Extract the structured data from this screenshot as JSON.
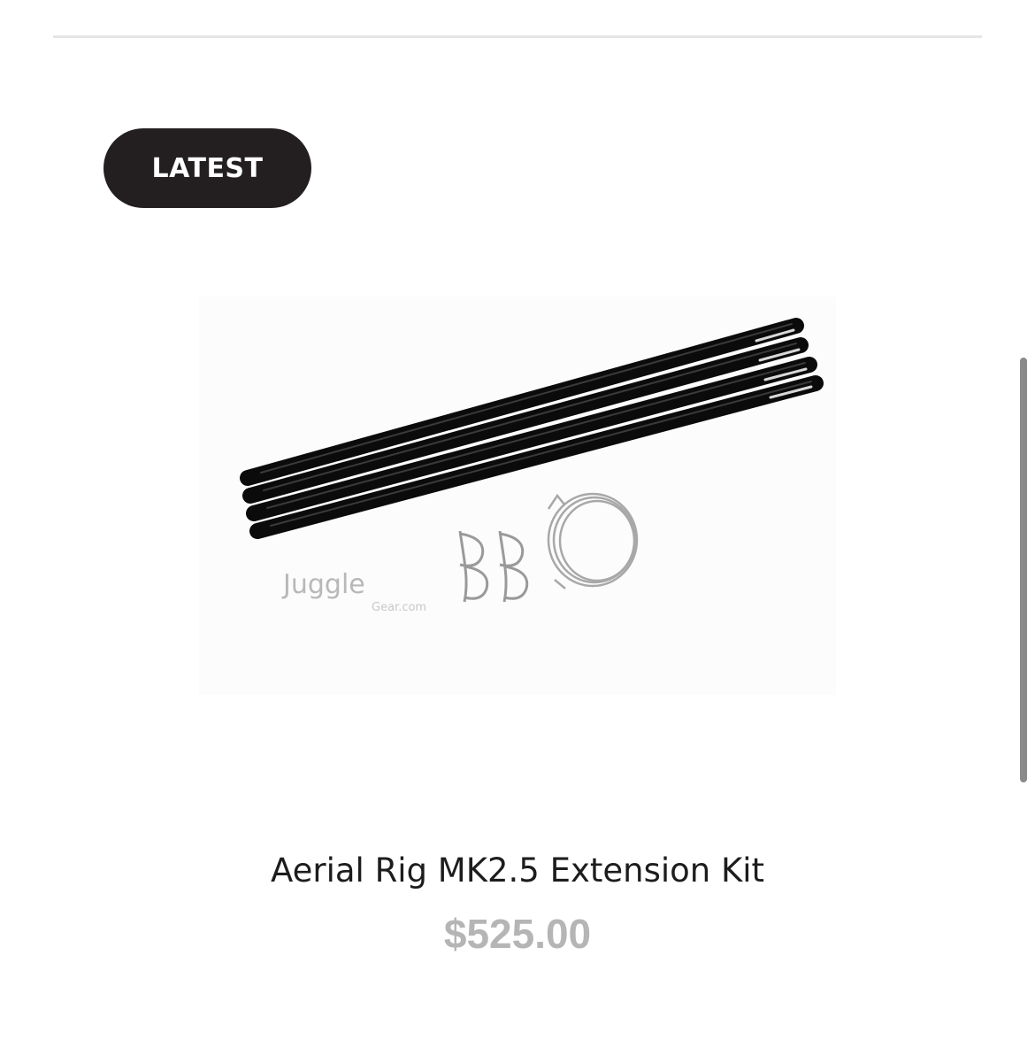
{
  "badge": {
    "label": "LATEST"
  },
  "product": {
    "image_watermark": "Juggle Gear.com",
    "image_watermark_main": "Juggle",
    "image_watermark_sub": "Gear.com",
    "title": "Aerial Rig MK2.5 Extension Kit",
    "price": "$525.00"
  },
  "colors": {
    "badge_bg": "#231e1f",
    "badge_text": "#ffffff",
    "title_text": "#1d1d1d",
    "price_text": "#b5b5b5",
    "divider": "#e6e6e6",
    "scrollbar": "#8a8a8a"
  }
}
